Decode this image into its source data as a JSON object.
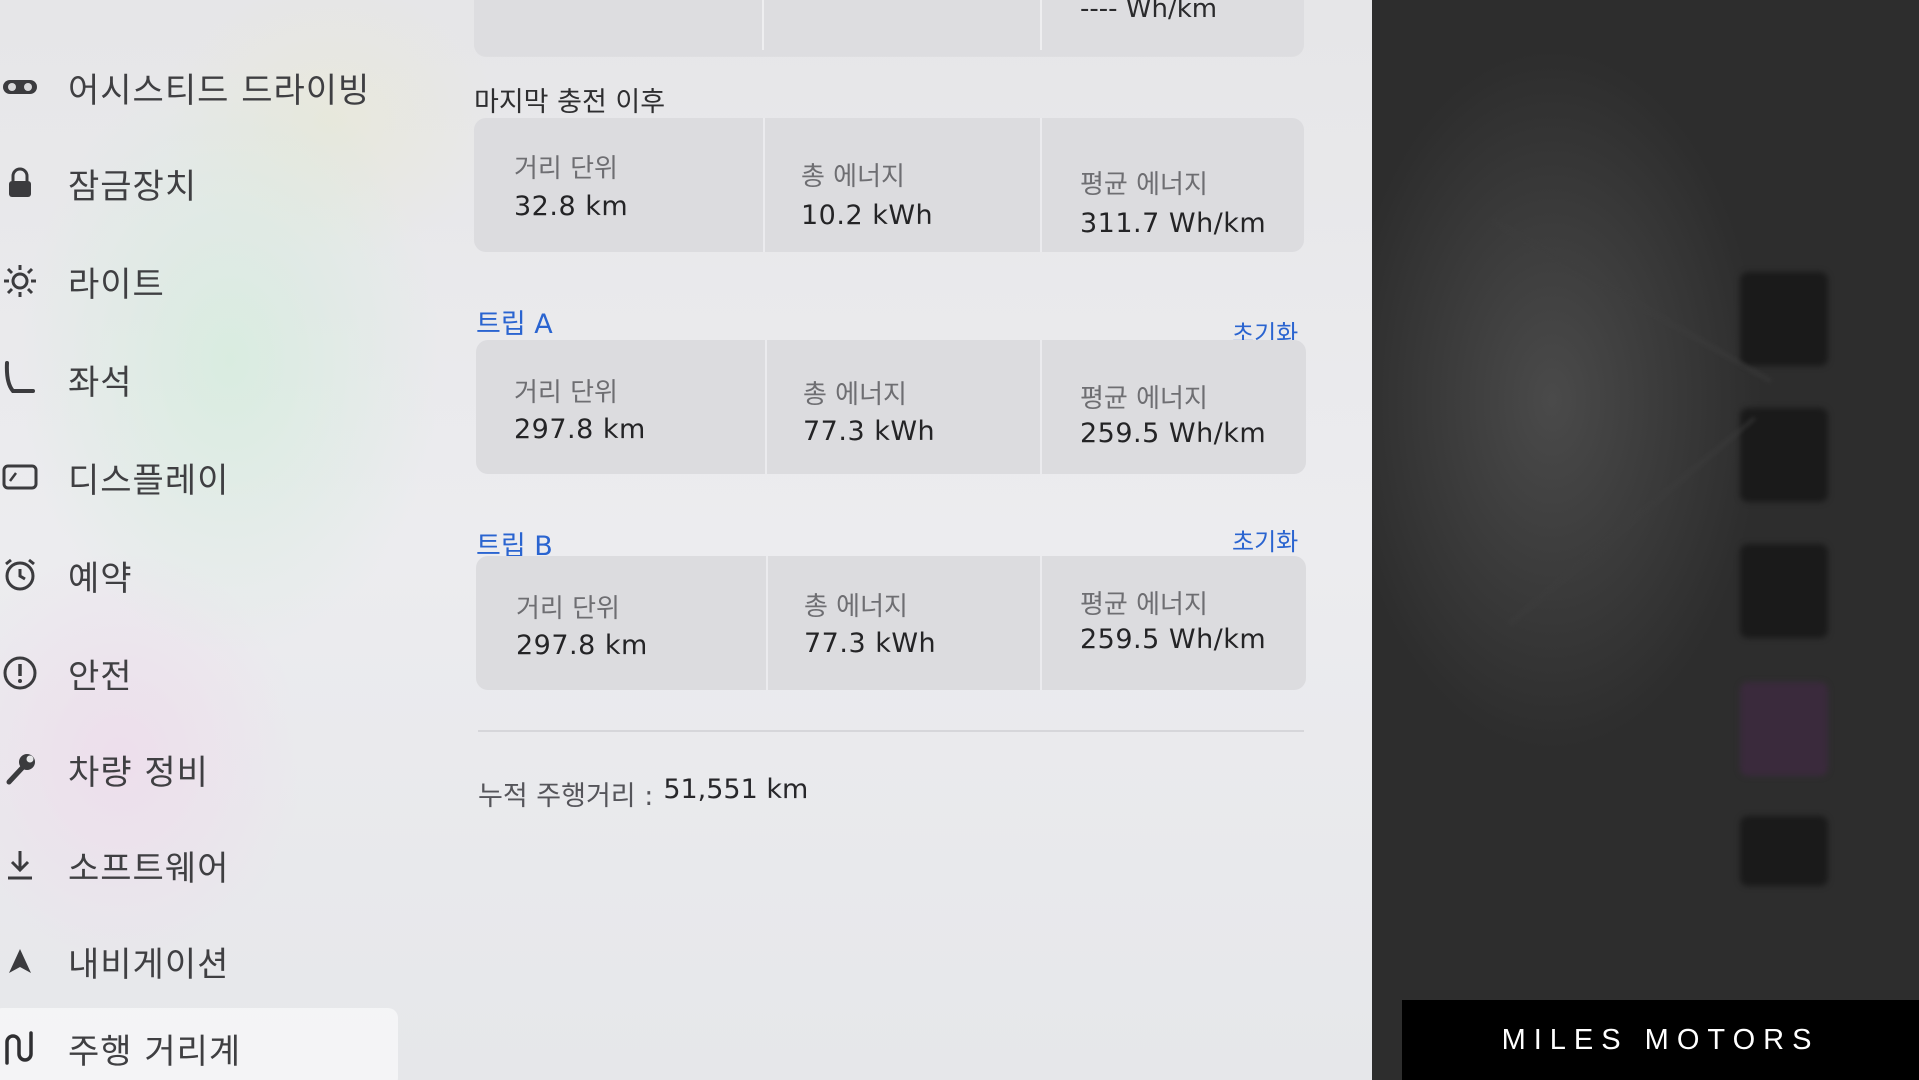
{
  "sidebar": {
    "items": [
      {
        "label": "어시스티드 드라이빙",
        "icon": "steering-assist-icon"
      },
      {
        "label": "잠금장치",
        "icon": "lock-icon"
      },
      {
        "label": "라이트",
        "icon": "light-icon"
      },
      {
        "label": "좌석",
        "icon": "seat-icon"
      },
      {
        "label": "디스플레이",
        "icon": "display-icon"
      },
      {
        "label": "예약",
        "icon": "alarm-clock-icon"
      },
      {
        "label": "안전",
        "icon": "safety-alert-icon"
      },
      {
        "label": "차량 정비",
        "icon": "wrench-icon"
      },
      {
        "label": "소프트웨어",
        "icon": "download-icon"
      },
      {
        "label": "내비게이션",
        "icon": "navigation-arrow-icon"
      },
      {
        "label": "주행 거리계",
        "icon": "trip-path-icon",
        "active": true
      }
    ]
  },
  "top_card": {
    "avg_energy": "---- Wh/km"
  },
  "since_last_charge": {
    "title": "마지막 충전 이후",
    "distance_label": "거리 단위",
    "distance": "32.8 km",
    "energy_label": "총 에너지",
    "energy": "10.2 kWh",
    "avg_label": "평균 에너지",
    "avg": "311.7 Wh/km"
  },
  "trip_a": {
    "title": "트립 A",
    "reset": "초기화",
    "distance_label": "거리 단위",
    "distance": "297.8 km",
    "energy_label": "총 에너지",
    "energy": "77.3 kWh",
    "avg_label": "평균 에너지",
    "avg": "259.5 Wh/km"
  },
  "trip_b": {
    "title": "트립 B",
    "reset": "초기화",
    "distance_label": "거리 단위",
    "distance": "297.8 km",
    "energy_label": "총 에너지",
    "energy": "77.3 kWh",
    "avg_label": "평균 에너지",
    "avg": "259.5 Wh/km"
  },
  "odometer": {
    "label": "누적 주행거리 :",
    "value": "51,551 km"
  },
  "watermark": "MILES MOTORS",
  "colors": {
    "accent": "#2a64d0",
    "panel": "#e8e8eb",
    "card": "#dcdcdf"
  }
}
